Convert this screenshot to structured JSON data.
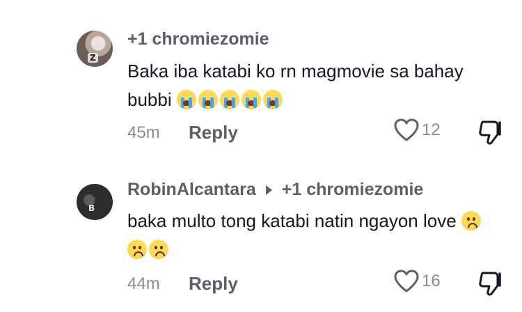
{
  "comments": [
    {
      "author": "+1 chromiezomie",
      "avatar_mark": "Z",
      "text_line1": "Baka iba katabi ko rn magmovie sa bahay",
      "text_line2": "bubbi",
      "emojis": [
        "loudly-crying-face",
        "loudly-crying-face",
        "loudly-crying-face",
        "loudly-crying-face",
        "loudly-crying-face"
      ],
      "time": "45m",
      "reply_label": "Reply",
      "likes": "12"
    },
    {
      "author": "RobinAlcantara",
      "reply_to": "+1 chromiezomie",
      "avatar_mark": "B",
      "text_line1": "baka multo tong katabi natin ngayon love",
      "emojis": [
        "worried-face",
        "worried-face",
        "worried-face"
      ],
      "time": "44m",
      "reply_label": "Reply",
      "likes": "16"
    }
  ],
  "colors": {
    "author": "#5c5f66",
    "text": "#161823",
    "meta": "#8a8b91",
    "background": "#ffffff"
  },
  "icons": {
    "like": "heart-outline-icon",
    "dislike": "thumbs-down-outline-icon"
  }
}
